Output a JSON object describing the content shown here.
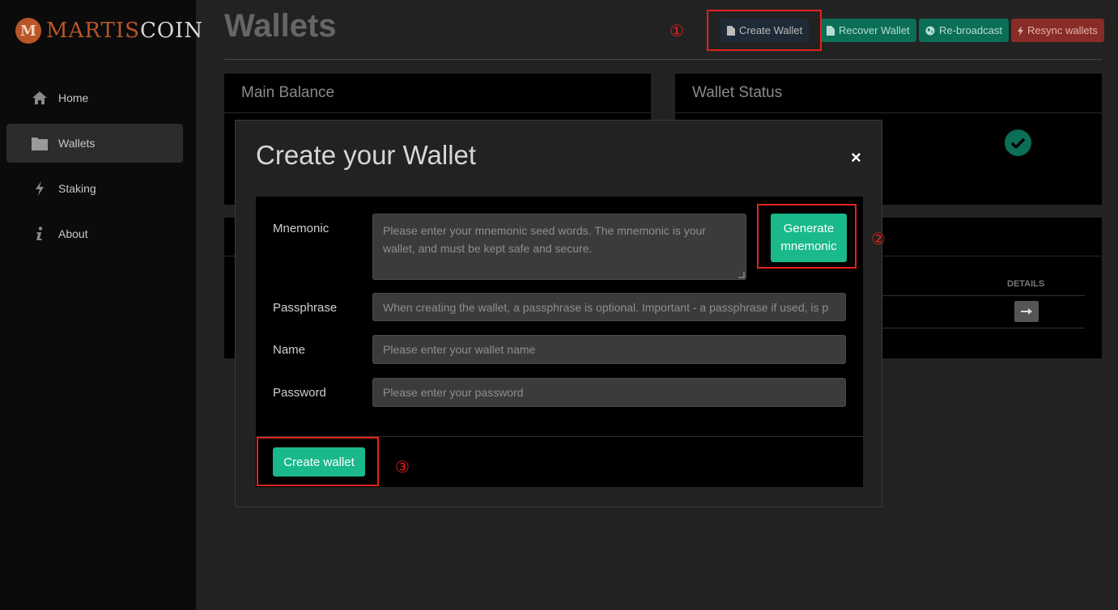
{
  "brand": {
    "mark": "M",
    "name_part1": "MARTIS",
    "name_part2": "COIN"
  },
  "sidebar": {
    "items": [
      {
        "label": "Home",
        "icon": "home-icon"
      },
      {
        "label": "Wallets",
        "icon": "folder-icon",
        "active": true
      },
      {
        "label": "Staking",
        "icon": "lightning-icon"
      },
      {
        "label": "About",
        "icon": "info-icon"
      }
    ]
  },
  "header": {
    "title": "Wallets",
    "buttons": {
      "create": "Create Wallet",
      "recover": "Recover Wallet",
      "rebroadcast": "Re-broadcast",
      "resync": "Resync wallets"
    }
  },
  "panels": {
    "main_balance": "Main Balance",
    "wallet_status": "Wallet Status",
    "details_header": "DETAILS"
  },
  "modal": {
    "title": "Create your Wallet",
    "close": "×",
    "fields": {
      "mnemonic_label": "Mnemonic",
      "mnemonic_placeholder": "Please enter your mnemonic seed words. The mnemonic is your wallet, and must be kept safe and secure.",
      "passphrase_label": "Passphrase",
      "passphrase_placeholder": "When creating the wallet, a passphrase is optional. Important - a passphrase if used, is p",
      "name_label": "Name",
      "name_placeholder": "Please enter your wallet name",
      "password_label": "Password",
      "password_placeholder": "Please enter your password"
    },
    "generate_button": "Generate mnemonic",
    "create_button": "Create wallet"
  },
  "annotations": {
    "step1": "①",
    "step2": "②",
    "step3": "③"
  },
  "colors": {
    "accent_green": "#19b98b",
    "highlight_red": "#e3231c",
    "brand_orange": "#b8562a"
  }
}
